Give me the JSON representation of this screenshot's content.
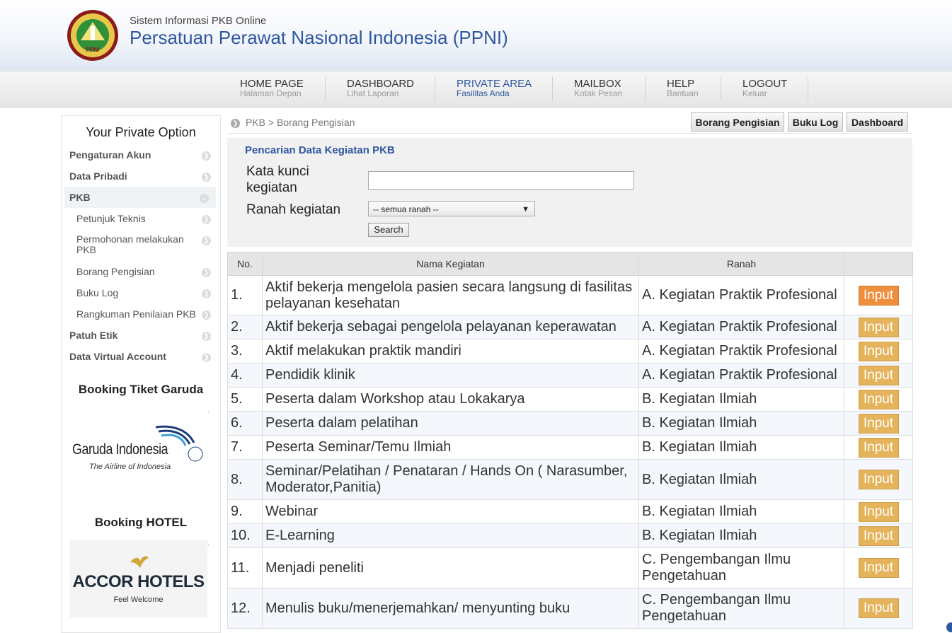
{
  "header": {
    "subtitle": "Sistem Informasi PKB Online",
    "title": "Persatuan Perawat Nasional Indonesia (PPNI)",
    "logo_text": "PPNI"
  },
  "nav": [
    {
      "label": "HOME PAGE",
      "sub": "Halaman Depan"
    },
    {
      "label": "DASHBOARD",
      "sub": "Lihat Laporan"
    },
    {
      "label": "PRIVATE AREA",
      "sub": "Fasilitas Anda",
      "active": true
    },
    {
      "label": "MAILBOX",
      "sub": "Kotak Pesan"
    },
    {
      "label": "HELP",
      "sub": "Bantuan"
    },
    {
      "label": "LOGOUT",
      "sub": "Keluar"
    }
  ],
  "sidebar": {
    "title": "Your Private Option",
    "items": [
      {
        "label": "Pengaturan Akun"
      },
      {
        "label": "Data Pribadi"
      },
      {
        "label": "PKB"
      },
      {
        "label": "Petunjuk Teknis"
      },
      {
        "label": "Permohonan melakukan PKB"
      },
      {
        "label": "Borang Pengisian"
      },
      {
        "label": "Buku Log"
      },
      {
        "label": "Rangkuman Penilaian PKB"
      },
      {
        "label": "Patuh Etik"
      },
      {
        "label": "Data Virtual Account"
      }
    ],
    "garuda_title": "Booking Tiket Garuda",
    "garuda_name": "Garuda Indonesia",
    "garuda_tagline": "The Airline of Indonesia",
    "hotel_title": "Booking HOTEL",
    "hotel_name": "ACCOR HOTELS",
    "hotel_tagline": "Feel Welcome"
  },
  "breadcrumb": "PKB > Borang Pengisian",
  "top_buttons": {
    "borang": "Borang Pengisian",
    "bukulog": "Buku Log",
    "dashboard": "Dashboard"
  },
  "search": {
    "title": "Pencarian Data Kegiatan PKB",
    "keyword_label_1": "Kata kunci",
    "keyword_label_2": "kegiatan",
    "keyword_value": "",
    "ranah_label": "Ranah kegiatan",
    "ranah_selected": "-- semua ranah --",
    "button": "Search"
  },
  "table": {
    "headers": [
      "No.",
      "Nama Kegiatan",
      "Ranah",
      ""
    ],
    "rows": [
      {
        "no": "1.",
        "nama": "Aktif bekerja mengelola pasien secara langsung di fasilitas pelayanan kesehatan",
        "ranah": "A. Kegiatan Praktik Profesional",
        "action": "Input"
      },
      {
        "no": "2.",
        "nama": "Aktif bekerja sebagai pengelola pelayanan keperawatan",
        "ranah": "A. Kegiatan Praktik Profesional",
        "action": "Input"
      },
      {
        "no": "3.",
        "nama": "Aktif melakukan praktik mandiri",
        "ranah": "A. Kegiatan Praktik Profesional",
        "action": "Input"
      },
      {
        "no": "4.",
        "nama": "Pendidik klinik",
        "ranah": "A. Kegiatan Praktik Profesional",
        "action": "Input"
      },
      {
        "no": "5.",
        "nama": "Peserta dalam Workshop atau Lokakarya",
        "ranah": "B. Kegiatan Ilmiah",
        "action": "Input"
      },
      {
        "no": "6.",
        "nama": "Peserta dalam pelatihan",
        "ranah": "B. Kegiatan Ilmiah",
        "action": "Input"
      },
      {
        "no": "7.",
        "nama": "Peserta Seminar/Temu Ilmiah",
        "ranah": "B. Kegiatan Ilmiah",
        "action": "Input"
      },
      {
        "no": "8.",
        "nama": "Seminar/Pelatihan / Penataran / Hands On ( Narasumber, Moderator,Panitia)",
        "ranah": "B. Kegiatan Ilmiah",
        "action": "Input"
      },
      {
        "no": "9.",
        "nama": "Webinar",
        "ranah": "B. Kegiatan Ilmiah",
        "action": "Input"
      },
      {
        "no": "10.",
        "nama": "E-Learning",
        "ranah": "B. Kegiatan Ilmiah",
        "action": "Input"
      },
      {
        "no": "11.",
        "nama": "Menjadi peneliti",
        "ranah": "C. Pengembangan Ilmu Pengetahuan",
        "action": "Input"
      },
      {
        "no": "12.",
        "nama": "Menulis buku/menerjemahkan/ menyunting buku",
        "ranah": "C. Pengembangan Ilmu Pengetahuan",
        "action": "Input"
      }
    ]
  },
  "colors": {
    "brand_blue": "#2f57a0",
    "input_button": "#e4b35a",
    "input_button_hover": "#ef8e3d"
  }
}
